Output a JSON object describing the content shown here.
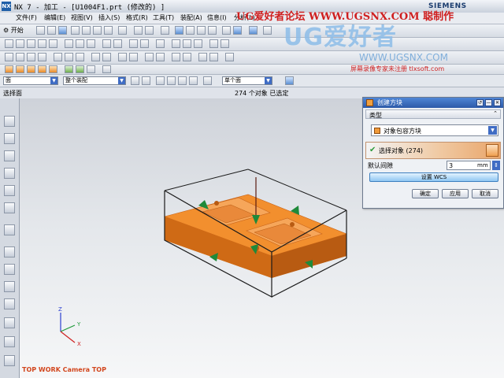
{
  "window": {
    "app_logo": "NX",
    "title": "NX 7 - 加工 - [U1004F1.prt  (修改的) ]",
    "brand": "SIEMENS",
    "forum_banner": "UG爱好者论坛 WWW.UGSNX.COM 聪制作"
  },
  "watermark": {
    "logo_text": "UG爱好者",
    "url": "WWW.UGSNX.COM",
    "tagline": "屏幕录像专家未注册 tlxsoft.com"
  },
  "menubar": {
    "items": [
      "文件(F)",
      "编辑(E)",
      "视图(V)",
      "插入(S)",
      "格式(R)",
      "工具(T)",
      "装配(A)",
      "信息(I)",
      "分析(L)"
    ]
  },
  "toolbar": {
    "start_label": "开始"
  },
  "filterbar": {
    "filter_value": "面",
    "assembly_value": "整个装配",
    "face_rule_value": "单个面"
  },
  "statusbar": {
    "prompt": "选择面",
    "status": "274 个对象 已选定"
  },
  "viewport": {
    "view_label": "TOP WORK Camera TOP",
    "triad": {
      "z": "Z",
      "y": "Y",
      "x": "X"
    },
    "colors": {
      "part": "#f08a2a",
      "block_edge": "#1a1a1a",
      "arrow": "#1f8a3a"
    }
  },
  "dialog": {
    "title": "创建方块",
    "section_type": "类型",
    "type_value": "对象包容方块",
    "select_label": "选择对象 (274)",
    "gap_label": "默认间隙",
    "gap_value": "3",
    "gap_unit": "mm",
    "csys_button": "设置 WCS",
    "ok_button": "确定",
    "apply_button": "应用",
    "cancel_button": "取消"
  }
}
